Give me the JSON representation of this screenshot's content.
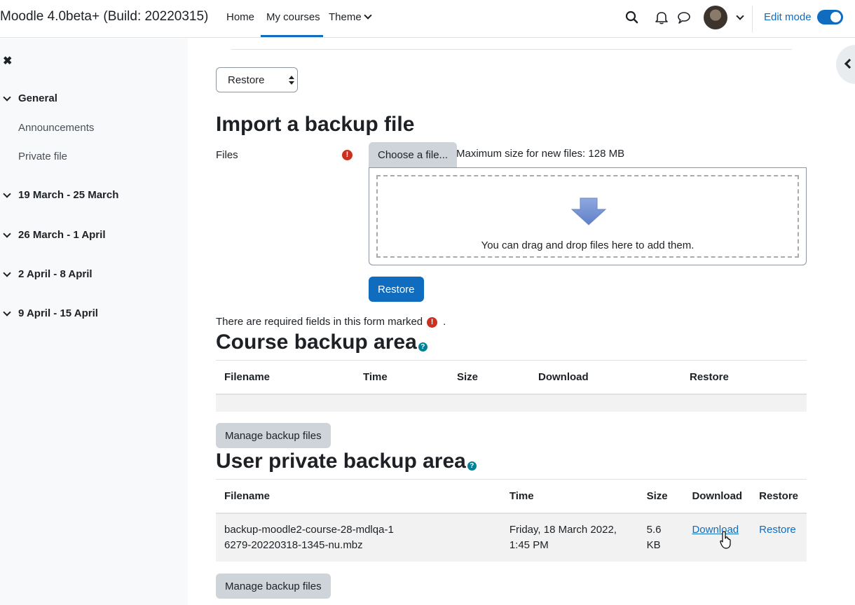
{
  "navbar": {
    "brand": "Moodle 4.0beta+ (Build: 20220315)",
    "links": [
      "Home",
      "My courses",
      "Theme"
    ],
    "active_link": "My courses",
    "edit_mode_label": "Edit mode",
    "edit_mode_on": true
  },
  "drawer": {
    "sections": [
      {
        "label": "General",
        "items": [
          "Announcements",
          "Private file"
        ]
      },
      {
        "label": "19 March - 25 March"
      },
      {
        "label": "26 March - 1 April"
      },
      {
        "label": "2 April - 8 April"
      },
      {
        "label": "9 April - 15 April"
      }
    ]
  },
  "main": {
    "select_value": "Restore",
    "import": {
      "heading": "Import a backup file",
      "files_label": "Files",
      "choose_button": "Choose a file...",
      "max_size": "Maximum size for new files: 128 MB",
      "drop_text": "You can drag and drop files here to add them.",
      "restore_button": "Restore",
      "required_note": "There are required fields in this form marked",
      "required_note_end": "."
    },
    "course_backup": {
      "heading": "Course backup area",
      "columns": [
        "Filename",
        "Time",
        "Size",
        "Download",
        "Restore"
      ],
      "manage_button": "Manage backup files"
    },
    "user_backup": {
      "heading": "User private backup area",
      "columns": [
        "Filename",
        "Time",
        "Size",
        "Download",
        "Restore"
      ],
      "rows": [
        {
          "filename": "backup-moodle2-course-28-mdlqa-16279-20220318-1345-nu.mbz",
          "time": "Friday, 18 March 2022, 1:45 PM",
          "size": "5.6 KB",
          "download": "Download",
          "restore": "Restore"
        }
      ],
      "manage_button": "Manage backup files"
    }
  },
  "colors": {
    "primary": "#0f6cbf",
    "required": "#ca3120",
    "help": "#008196"
  },
  "icons": {
    "search": "search-icon",
    "notifications": "bell-icon",
    "messages": "chat-icon",
    "close_drawer": "close-icon",
    "open_right_drawer": "chevron-left-icon"
  }
}
